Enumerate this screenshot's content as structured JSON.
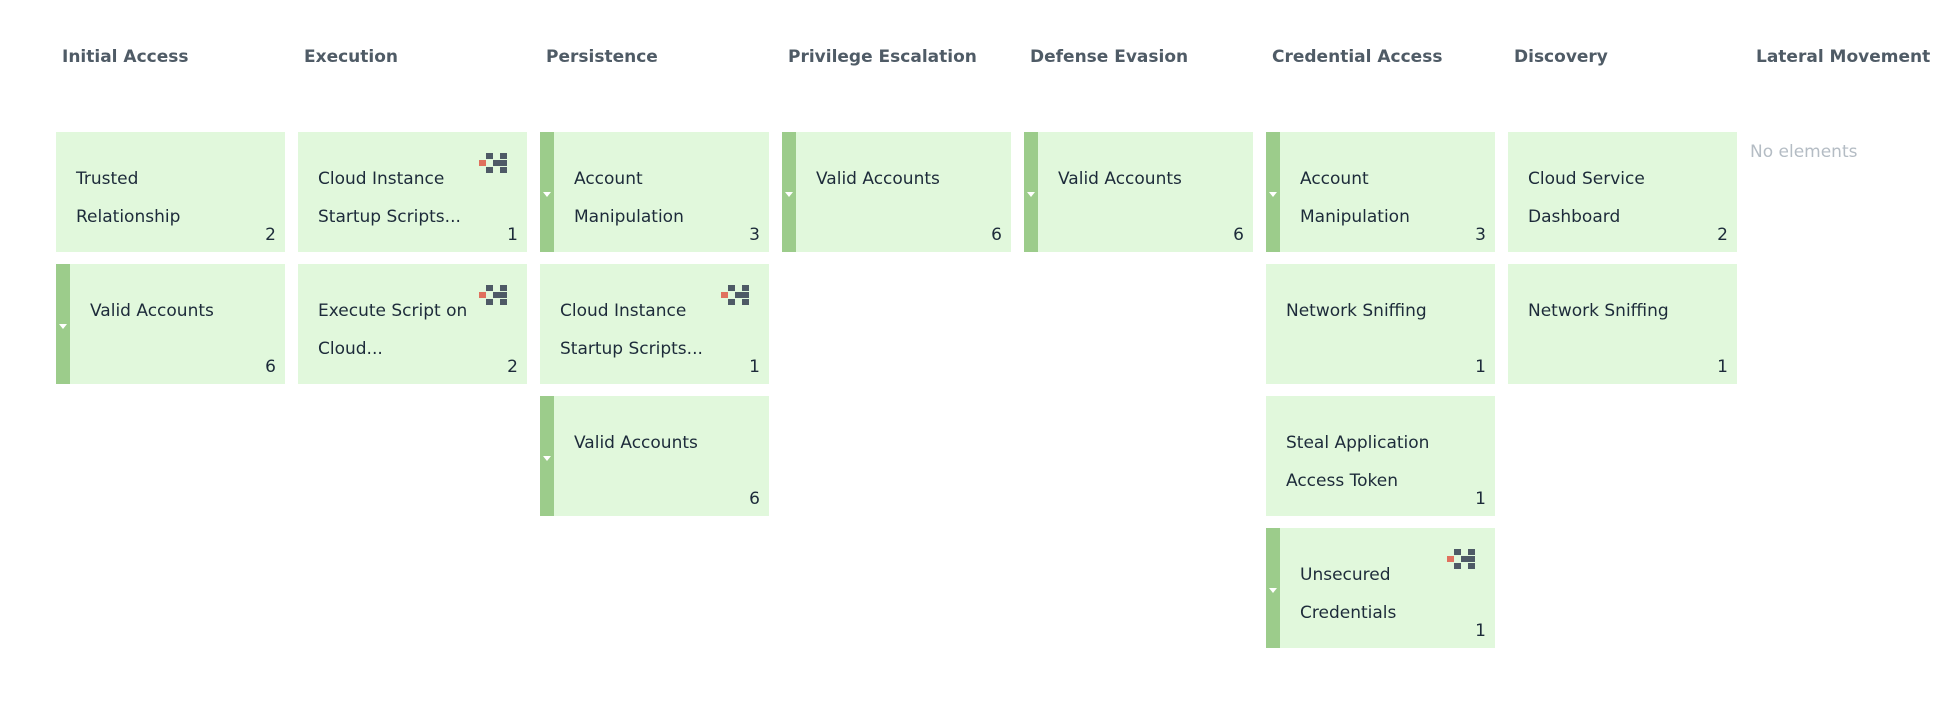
{
  "tactics": [
    {
      "title": "Initial Access",
      "techniques": [
        {
          "name": "Trusted Relationship",
          "count": "2",
          "sub": false,
          "logo": false
        },
        {
          "name": "Valid Accounts",
          "count": "6",
          "sub": true,
          "logo": false
        }
      ]
    },
    {
      "title": "Execution",
      "techniques": [
        {
          "name": "Cloud Instance Startup Scripts...",
          "count": "1",
          "sub": false,
          "logo": true
        },
        {
          "name": "Execute Script on Cloud...",
          "count": "2",
          "sub": false,
          "logo": true
        }
      ]
    },
    {
      "title": "Persistence",
      "techniques": [
        {
          "name": "Account Manipulation",
          "count": "3",
          "sub": true,
          "logo": false
        },
        {
          "name": "Cloud Instance Startup Scripts...",
          "count": "1",
          "sub": false,
          "logo": true
        },
        {
          "name": "Valid Accounts",
          "count": "6",
          "sub": true,
          "logo": false
        }
      ]
    },
    {
      "title": "Privilege Escalation",
      "techniques": [
        {
          "name": "Valid Accounts",
          "count": "6",
          "sub": true,
          "logo": false
        }
      ]
    },
    {
      "title": "Defense Evasion",
      "techniques": [
        {
          "name": "Valid Accounts",
          "count": "6",
          "sub": true,
          "logo": false
        }
      ]
    },
    {
      "title": "Credential Access",
      "techniques": [
        {
          "name": "Account Manipulation",
          "count": "3",
          "sub": true,
          "logo": false
        },
        {
          "name": "Network Sniffing",
          "count": "1",
          "sub": false,
          "logo": false
        },
        {
          "name": "Steal Application Access Token",
          "count": "1",
          "sub": false,
          "logo": false
        },
        {
          "name": "Unsecured Credentials",
          "count": "1",
          "sub": true,
          "logo": true
        }
      ]
    },
    {
      "title": "Discovery",
      "techniques": [
        {
          "name": "Cloud Service Dashboard",
          "count": "2",
          "sub": false,
          "logo": false
        },
        {
          "name": "Network Sniffing",
          "count": "1",
          "sub": false,
          "logo": false
        }
      ]
    },
    {
      "title": "Lateral Movement",
      "techniques": [],
      "empty_text": "No elements"
    }
  ],
  "colors": {
    "cell_background": "#e1f8dc",
    "subtechnique_bar": "#9ccc8b",
    "header_text": "#4f5b66",
    "empty_text": "#b4bcc4",
    "logo_dark": "#4e5a66",
    "logo_accent": "#e0715e"
  },
  "icons": {
    "expand": "caret-down-icon",
    "provider": "provider-logo-icon"
  }
}
